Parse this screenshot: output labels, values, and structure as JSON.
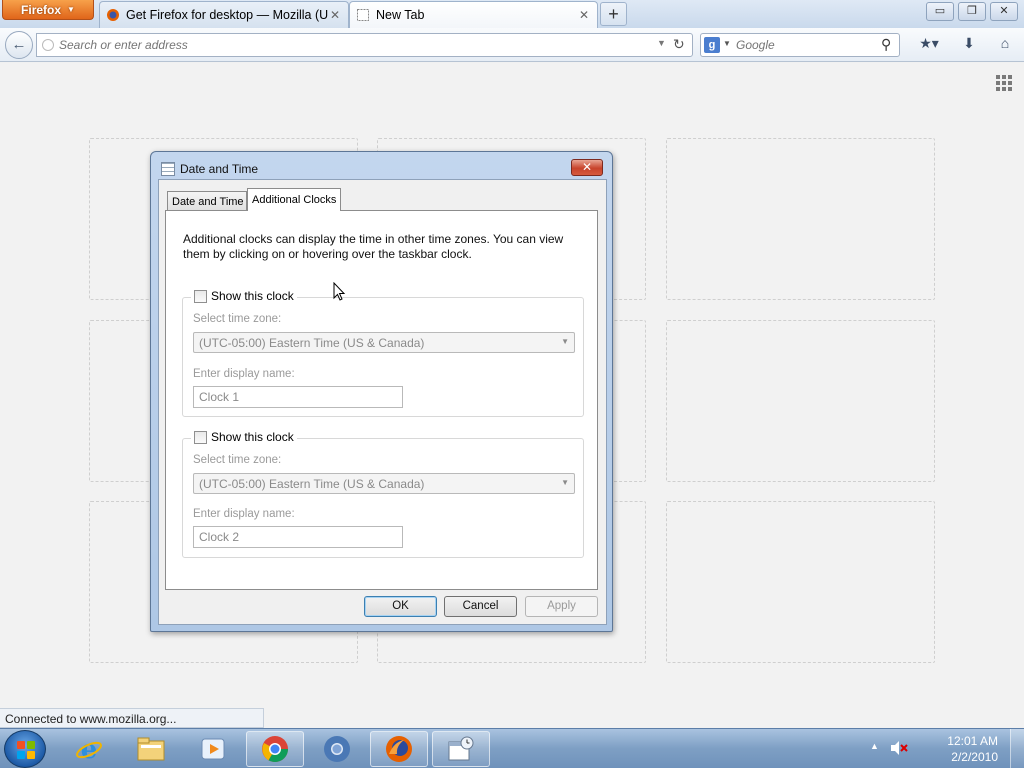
{
  "browser": {
    "menu_label": "Firefox",
    "tabs": [
      {
        "title": "Get Firefox for desktop — Mozilla (US)"
      },
      {
        "title": "New Tab"
      }
    ],
    "new_tab_symbol": "+",
    "url_placeholder": "Search or enter address",
    "search_engine": "g-icon",
    "search_placeholder": "Google",
    "status_text": "Connected to www.mozilla.org..."
  },
  "dialog": {
    "title": "Date and Time",
    "tabs": [
      {
        "label": "Date and Time"
      },
      {
        "label": "Additional Clocks"
      }
    ],
    "intro": "Additional clocks can display the time in other time zones. You can view them by clicking on or hovering over the taskbar clock.",
    "clocks": [
      {
        "checkbox_label": "Show this clock",
        "timezone_label": "Select time zone:",
        "timezone_value": "(UTC-05:00) Eastern Time (US & Canada)",
        "name_label": "Enter display name:",
        "name_value": "Clock 1"
      },
      {
        "checkbox_label": "Show this clock",
        "timezone_label": "Select time zone:",
        "timezone_value": "(UTC-05:00) Eastern Time (US & Canada)",
        "name_label": "Enter display name:",
        "name_value": "Clock 2"
      }
    ],
    "buttons": {
      "ok": "OK",
      "cancel": "Cancel",
      "apply": "Apply"
    }
  },
  "taskbar": {
    "time": "12:01 AM",
    "date": "2/2/2010",
    "apps": [
      {
        "name": "internet-explorer-icon"
      },
      {
        "name": "file-explorer-icon"
      },
      {
        "name": "media-player-icon"
      },
      {
        "name": "chrome-icon"
      },
      {
        "name": "chromium-icon"
      },
      {
        "name": "firefox-icon"
      },
      {
        "name": "date-time-icon"
      }
    ]
  },
  "colors": {
    "firefox_orange": "#e0651a",
    "taskbar_blue": "#7e9fc4",
    "dialog_frame": "#aec7e5"
  }
}
